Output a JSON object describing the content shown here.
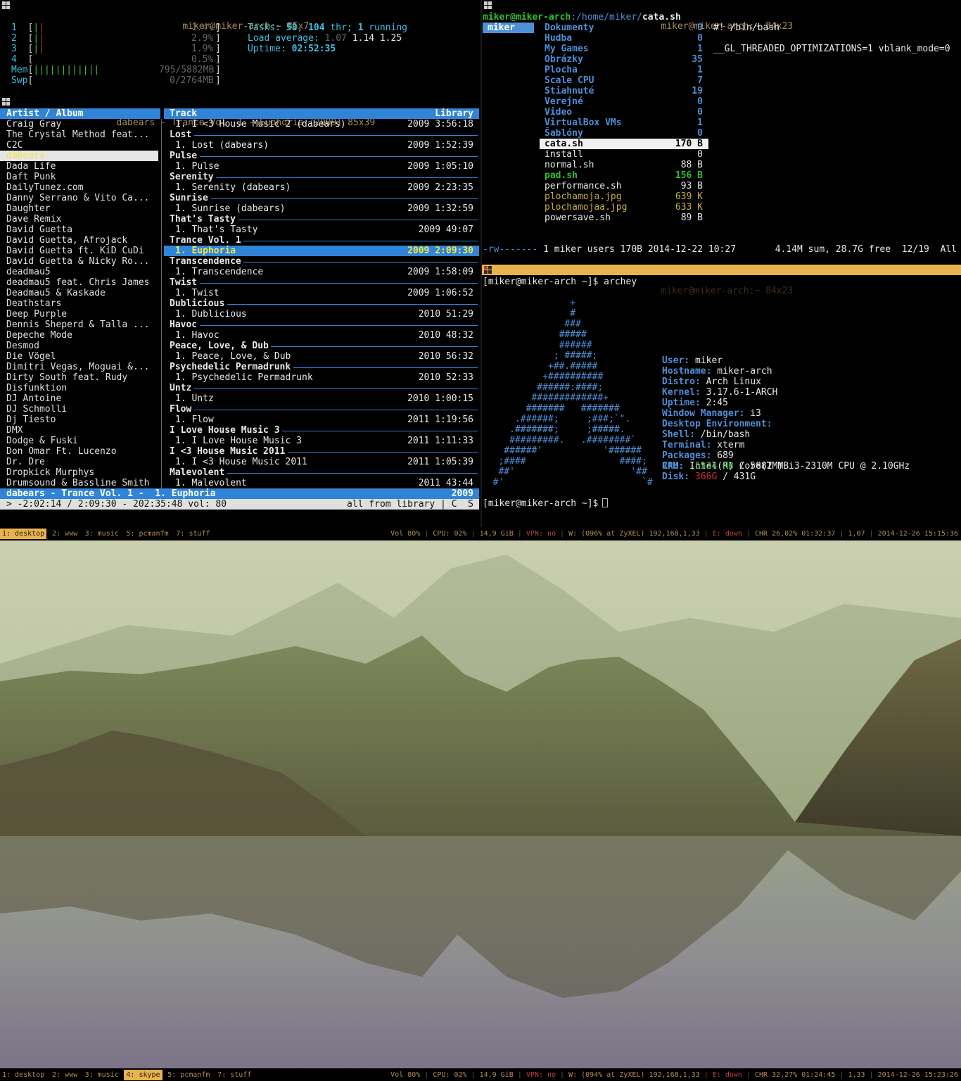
{
  "htop": {
    "title": "miker@miker-arch:~ 85x7",
    "cpus": [
      {
        "n": "1",
        "pct": "1.4%"
      },
      {
        "n": "2",
        "pct": "2.9%"
      },
      {
        "n": "3",
        "pct": "1.9%"
      },
      {
        "n": "4",
        "pct": "0.5%"
      }
    ],
    "mem_label": "Mem",
    "mem_value": "795/5882MB",
    "mem_bar": "||||||||||||",
    "swp_label": "Swp",
    "swp_value": "0/2764MB",
    "tasks_label": "Tasks:",
    "tasks_value": "58",
    "thr_value": "104",
    "thr_label": "thr;",
    "running_value": "1",
    "running_label": "running",
    "load_label": "Load average:",
    "load1": "1.07",
    "load5": "1.14",
    "load15": "1.25",
    "uptime_label": "Uptime:",
    "uptime_value": "02:52:35"
  },
  "ncmpcpp": {
    "title": "dabears - Trance Vol. 1 - Euphoria (2009) 85x39",
    "col_artist": "Artist / Album",
    "col_track": "Track",
    "col_library": "Library",
    "artists": [
      "Craig Gray",
      "The Crystal Method feat...",
      "C2C",
      "dabears",
      "Dada Life",
      "Daft Punk",
      "DailyTunez.com",
      "Danny Serrano & Vito Ca...",
      "Daughter",
      "Dave Remix",
      "David Guetta",
      "David Guetta, Afrojack",
      "David Guetta ft. KiD CuDi",
      "David Guetta & Nicky Ro...",
      "deadmau5",
      "deadmau5 feat. Chris James",
      "Deadmau5 & Kaskade",
      "Deathstars",
      "Deep Purple",
      "Dennis Sheperd & Talla ...",
      "Depeche Mode",
      "Desmod",
      "Die Vögel",
      "Dimitri Vegas, Moguai &...",
      "Dirty South feat. Rudy",
      "Disfunktion",
      "DJ Antoine",
      "DJ Schmolli",
      "Dj Tiesto",
      "DMX",
      "Dodge & Fuski",
      "Don Omar Ft. Lucenzo",
      "Dr. Dre",
      "Dropkick Murphys",
      "Drumsound & Bassline Smith"
    ],
    "selected_artist_index": 3,
    "albums": [
      {
        "album": "",
        "track": "1. I <3 House Music 2 (dabears)",
        "year": "2009",
        "len": "3:56:18"
      },
      {
        "album": "Lost",
        "track": "1. Lost (dabears)",
        "year": "2009",
        "len": "1:52:39"
      },
      {
        "album": "Pulse",
        "track": "1. Pulse",
        "year": "2009",
        "len": "1:05:10"
      },
      {
        "album": "Serenity",
        "track": "1. Serenity (dabears)",
        "year": "2009",
        "len": "2:23:35"
      },
      {
        "album": "Sunrise",
        "track": "1. Sunrise (dabears)",
        "year": "2009",
        "len": "1:32:59"
      },
      {
        "album": "That's Tasty",
        "track": "1. That's Tasty",
        "year": "2009",
        "len": "49:07"
      },
      {
        "album": "Trance Vol. 1",
        "track": "1. Euphoria",
        "year": "2009",
        "len": "2:09:30",
        "selected": true
      },
      {
        "album": "Transcendence",
        "track": "1. Transcendence",
        "year": "2009",
        "len": "1:58:09"
      },
      {
        "album": "Twist",
        "track": "1. Twist",
        "year": "2009",
        "len": "1:06:52"
      },
      {
        "album": "Dublicious",
        "track": "1. Dublicious",
        "year": "2010",
        "len": "51:29"
      },
      {
        "album": "Havoc",
        "track": "1. Havoc",
        "year": "2010",
        "len": "48:32"
      },
      {
        "album": "Peace, Love, & Dub",
        "track": "1. Peace, Love, & Dub",
        "year": "2010",
        "len": "56:32"
      },
      {
        "album": "Psychedelic Permadrunk",
        "track": "1. Psychedelic Permadrunk",
        "year": "2010",
        "len": "52:33"
      },
      {
        "album": "Untz",
        "track": "1. Untz",
        "year": "2010",
        "len": "1:00:15"
      },
      {
        "album": "Flow",
        "track": "1. Flow",
        "year": "2011",
        "len": "1:19:56"
      },
      {
        "album": "I Love House Music 3",
        "track": "1. I Love House Music 3",
        "year": "2011",
        "len": "1:11:33"
      },
      {
        "album": "I <3 House Music 2011",
        "track": "1. I <3 House Music 2011",
        "year": "2011",
        "len": "1:05:39"
      },
      {
        "album": "Malevolent",
        "track": "1. Malevolent",
        "year": "2011",
        "len": "43:44"
      }
    ],
    "now_playing": "dabears - Trance Vol. 1 -  1. Euphoria",
    "now_playing_year": "2009",
    "status_left": "> -2:02:14 / 2:09:30 - 202:35:48 vol: 80",
    "status_right": "all from library | C  S"
  },
  "ranger": {
    "title": "miker@miker-arch:~ 84x23",
    "path_user": "miker@miker-arch",
    "path_dir": ":/home/miker/",
    "path_file": "cata.sh",
    "parent": "miker",
    "files": [
      {
        "name": "Dokumenty",
        "size": "0",
        "kind": "dir"
      },
      {
        "name": "Hudba",
        "size": "0",
        "kind": "dir"
      },
      {
        "name": "My Games",
        "size": "1",
        "kind": "dir"
      },
      {
        "name": "Obrázky",
        "size": "35",
        "kind": "dir"
      },
      {
        "name": "Plocha",
        "size": "1",
        "kind": "dir"
      },
      {
        "name": "Scale CPU",
        "size": "7",
        "kind": "dir"
      },
      {
        "name": "Stiahnuté",
        "size": "19",
        "kind": "dir"
      },
      {
        "name": "Verejné",
        "size": "0",
        "kind": "dir"
      },
      {
        "name": "Video",
        "size": "0",
        "kind": "dir"
      },
      {
        "name": "VirtualBox VMs",
        "size": "1",
        "kind": "dir"
      },
      {
        "name": "Šablóny",
        "size": "0",
        "kind": "dir"
      },
      {
        "name": "cata.sh",
        "size": "170 B",
        "kind": "sel"
      },
      {
        "name": "install",
        "size": "0",
        "kind": "file"
      },
      {
        "name": "normal.sh",
        "size": "88 B",
        "kind": "file"
      },
      {
        "name": "pad.sh",
        "size": "156 B",
        "kind": "exec"
      },
      {
        "name": "performance.sh",
        "size": "93 B",
        "kind": "file"
      },
      {
        "name": "plochamoja.jpg",
        "size": "639 K",
        "kind": "img"
      },
      {
        "name": "plochamojaa.jpg",
        "size": "633 K",
        "kind": "img"
      },
      {
        "name": "powersave.sh",
        "size": "89 B",
        "kind": "file"
      }
    ],
    "preview": [
      "#! /bin/bash",
      "",
      "__GL_THREADED_OPTIMIZATIONS=1 vblank_mode=0"
    ],
    "status_perm": "-rw-------",
    "status_info": " 1 miker users 170B 2014-12-22 10:27",
    "status_right": "4.14M sum, 28.7G free  12/19  All"
  },
  "archey": {
    "title": "miker@miker-arch:~ 84x23",
    "prompt1": "[miker@miker-arch ~]$ archey",
    "prompt2": "[miker@miker-arch ~]$",
    "logo": [
      "                +",
      "                #",
      "               ###",
      "              #####",
      "              ######",
      "             ; #####;",
      "            +##.#####",
      "           +##########",
      "          ######:####;",
      "         #############+",
      "        #######   #######",
      "      .######;     ;###;`\".",
      "     .#######;     ;#####.",
      "     #########.   .########`",
      "    ######'           '######",
      "   ;####                 ####;",
      "   ##'                     '##",
      "  #'                         `#"
    ],
    "info": [
      {
        "k": "User:",
        "v": " miker"
      },
      {
        "k": "Hostname:",
        "v": " miker-arch"
      },
      {
        "k": "Distro:",
        "v": " Arch Linux"
      },
      {
        "k": "Kernel:",
        "v": " 3.17.6-1-ARCH"
      },
      {
        "k": "Uptime:",
        "v": " 2:45"
      },
      {
        "k": "Window Manager:",
        "v": " i3"
      },
      {
        "k": "Desktop Environment:",
        "v": ""
      },
      {
        "k": "Shell:",
        "v": " /bin/bash"
      },
      {
        "k": "Terminal:",
        "v": " xterm"
      },
      {
        "k": "Packages:",
        "v": " 689"
      },
      {
        "k": "CPU:",
        "v": " Intel(R) Core(TM) i3-2310M CPU @ 2.10GHz"
      }
    ],
    "ram_label": "RAM:",
    "ram_used": "-5534 MB",
    "ram_total": " / 5882 MB",
    "disk_label": "Disk:",
    "disk_used": "366G",
    "disk_total": " / 431G"
  },
  "bar_top": {
    "workspaces": [
      "1: desktop",
      "2: www",
      "3: music",
      "5: pcmanfm",
      "7: stuff"
    ],
    "focused": 0,
    "status": [
      "Vol 80%",
      "CPU: 02%",
      "14,9 GiB",
      "VPN: no",
      "W: (096% at ZyXEL) 192,168,1,33",
      "E: down",
      "CHR 26,02% 01:32:37",
      "1,07",
      "2014-12-26 15:15:36"
    ]
  },
  "bar_bottom": {
    "workspaces": [
      "1: desktop",
      "2: www",
      "3: music",
      "4: skype",
      "5: pcmanfm",
      "7: stuff"
    ],
    "focused": 3,
    "status": [
      "Vol 80%",
      "CPU: 02%",
      "14,9 GiB",
      "VPN: no",
      "W: (094% at ZyXEL) 192,168,1,33",
      "E: down",
      "CHR 32,27% 01:24:45",
      "1,33",
      "2014-12-26 15:23:26"
    ]
  },
  "colors": {
    "accent": "#e8b24f",
    "ncmpcpp_blue": "#2f84d8",
    "prompt_green": "#2fbf2f",
    "dir_blue": "#4f8fd6"
  }
}
